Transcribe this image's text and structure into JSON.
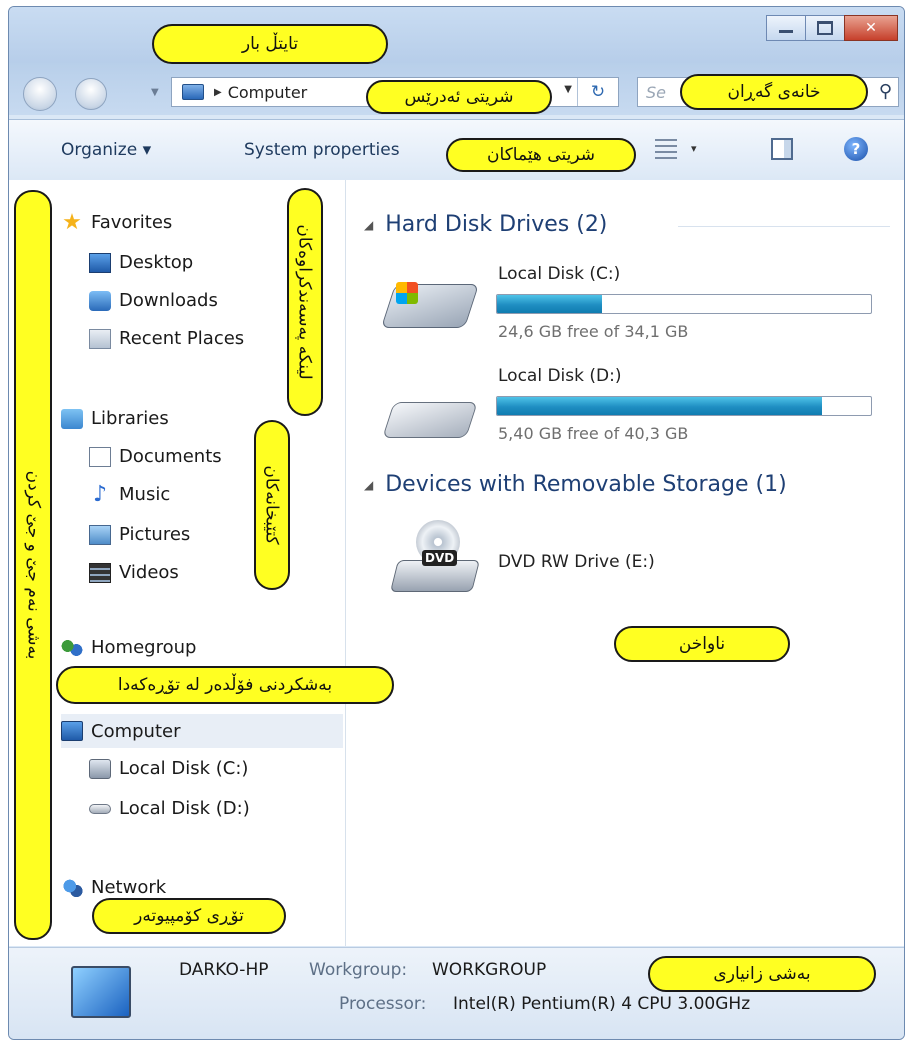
{
  "window": {
    "caption": {
      "minimize": "—",
      "maximize": "□",
      "close": "✕"
    }
  },
  "nav": {
    "address_path": "Computer",
    "refresh_glyph": "↻",
    "search_placeholder": "Se"
  },
  "toolbar": {
    "organize_label": "Organize ▾",
    "system_properties_label": "System properties",
    "views_dropdown": "▾",
    "help_glyph": "?"
  },
  "sidebar": {
    "favorites": {
      "label": "Favorites",
      "items": [
        "Desktop",
        "Downloads",
        "Recent Places"
      ]
    },
    "libraries": {
      "label": "Libraries",
      "items": [
        "Documents",
        "Music",
        "Pictures",
        "Videos"
      ]
    },
    "homegroup": "Homegroup",
    "computer": {
      "label": "Computer",
      "items": [
        "Local Disk (C:)",
        "Local Disk (D:)"
      ]
    },
    "network": "Network"
  },
  "content": {
    "hard_disk_group": "Hard Disk Drives (2)",
    "removable_group": "Devices with Removable Storage (1)",
    "drives": [
      {
        "name": "Local Disk (C:)",
        "free_text": "24,6 GB free of 34,1 GB",
        "used_fraction": 0.28
      },
      {
        "name": "Local Disk (D:)",
        "free_text": "5,40 GB free of 40,3 GB",
        "used_fraction": 0.87
      }
    ],
    "dvd": {
      "name": "DVD RW Drive (E:)",
      "badge": "DVD"
    }
  },
  "details": {
    "computer_name": "DARKO-HP",
    "workgroup_label": "Workgroup:",
    "workgroup": "WORKGROUP",
    "processor_label": "Processor:",
    "processor": "Intel(R) Pentium(R) 4 CPU 3.00GHz"
  },
  "annotations": {
    "title_bar": "تایتڵ بار",
    "address_bar": "شریتی ئەدرێس",
    "search_box": "خانەی گەڕان",
    "toolbar": "شریتی هێماکان",
    "favorite_links": "لینکە پەسەندکراوەکان",
    "libraries": "کتێبخانەکان",
    "navigation_pane": "بەشی نەم جێ و جێ کردن",
    "homegroup_sharing": "بەشکردنی فۆڵدەر لە تۆڕەکەدا",
    "network": "تۆڕی کۆمپیوتەر",
    "content_area": "ناواخن",
    "details_pane": "بەشی زانیاری"
  },
  "colors": {
    "callout": "#ffff22",
    "disk_fill": "#1f8ec2",
    "title_bar": "#c9dcf2"
  }
}
